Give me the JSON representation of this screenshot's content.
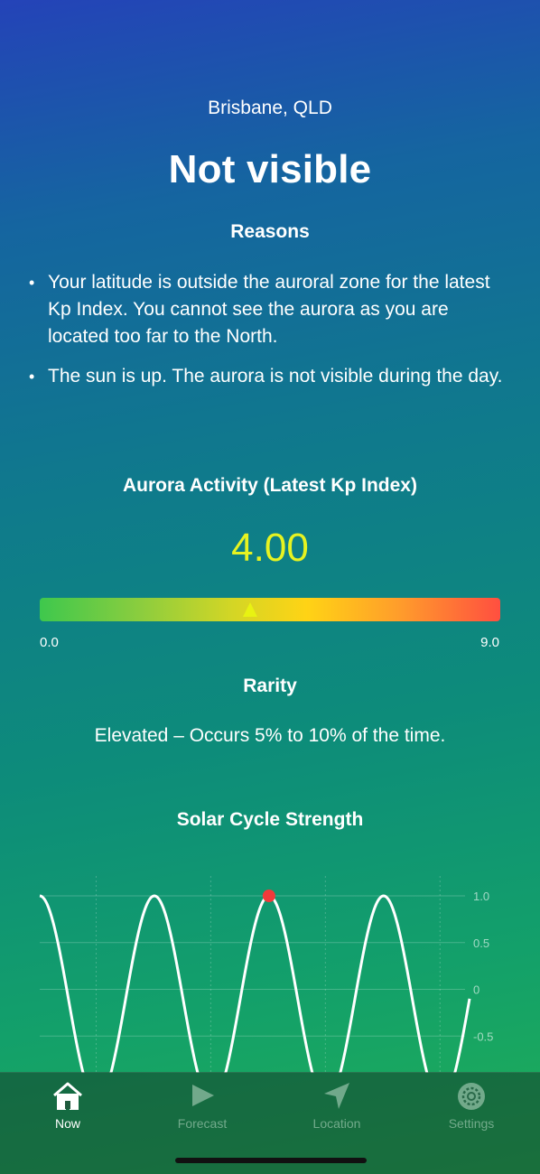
{
  "header": {
    "location": "Brisbane, QLD",
    "status": "Not visible"
  },
  "reasons": {
    "title": "Reasons",
    "items": [
      "Your latitude is outside the auroral zone for the latest Kp Index. You cannot see the aurora as you are located too far to the North.",
      "The sun is up. The aurora is not visible during the day."
    ]
  },
  "activity": {
    "title": "Aurora Activity (Latest Kp Index)",
    "kp_value": "4.00",
    "kp_numeric": 4.0,
    "scale_min": "0.0",
    "scale_max": "9.0"
  },
  "rarity": {
    "title": "Rarity",
    "text": "Elevated – Occurs 5% to 10% of the time."
  },
  "solar": {
    "title": "Solar Cycle Strength"
  },
  "chart_data": {
    "type": "line",
    "title": "Solar Cycle Strength",
    "xlabel": "",
    "ylabel": "",
    "y_tick_labels": [
      "1.0",
      "0.5",
      "0",
      "-0.5"
    ],
    "ylim": [
      -0.9,
      1.2
    ],
    "grid": true,
    "series": [
      {
        "x": [
          0,
          0.25,
          0.5,
          0.75,
          1.0,
          1.25,
          1.5,
          1.75,
          2.0,
          2.25,
          2.5,
          2.75,
          3.0,
          3.25,
          3.5,
          3.75
        ],
        "values": [
          0.43,
          -0.65,
          -0.9,
          0.0,
          1.0,
          0.0,
          -0.9,
          0.0,
          1.0,
          0.0,
          -0.9,
          0.0,
          1.0,
          0.0,
          -0.9,
          0.43
        ]
      }
    ],
    "highlight_point": {
      "x": 2.0,
      "y": 1.0,
      "color": "#f03a3a"
    },
    "line_color": "#ffffff"
  },
  "tabbar": {
    "tabs": [
      {
        "label": "Now",
        "icon": "home-icon",
        "active": true
      },
      {
        "label": "Forecast",
        "icon": "play-icon",
        "active": false
      },
      {
        "label": "Location",
        "icon": "location-arrow-icon",
        "active": false
      },
      {
        "label": "Settings",
        "icon": "gear-icon",
        "active": false
      }
    ]
  }
}
